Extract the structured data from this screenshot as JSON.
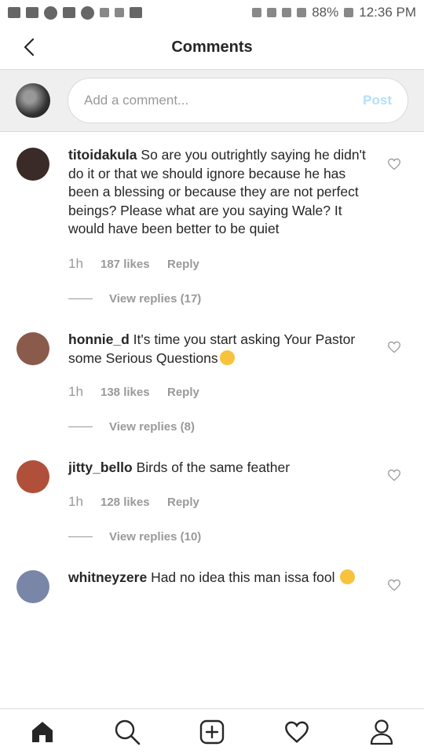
{
  "status_bar": {
    "battery": "88%",
    "time": "12:36 PM"
  },
  "header": {
    "title": "Comments"
  },
  "compose": {
    "placeholder": "Add a comment...",
    "post_label": "Post"
  },
  "comments": [
    {
      "username": "titoidakula",
      "text": "So are you outrightly saying he didn't do it or that we should ignore because he has been a blessing or because they are not perfect beings? Please what are you saying Wale? It would have been better to be quiet",
      "time": "1h",
      "likes": "187 likes",
      "reply_label": "Reply",
      "view_replies": "View replies (17)",
      "avatar_color": "#3a2a28"
    },
    {
      "username": "honnie_d",
      "text": "It's time you start asking Your Pastor some Serious Questions",
      "time": "1h",
      "likes": "138 likes",
      "reply_label": "Reply",
      "view_replies": "View replies (8)",
      "avatar_color": "#8a5a4a"
    },
    {
      "username": "jitty_bello",
      "text": "Birds of the same feather",
      "time": "1h",
      "likes": "128 likes",
      "reply_label": "Reply",
      "view_replies": "View replies (10)",
      "avatar_color": "#b0503a"
    },
    {
      "username": "whitneyzere",
      "text": "Had no idea this man issa fool",
      "avatar_color": "#7a86a8"
    }
  ],
  "bottom_nav": [
    "home-icon",
    "search-icon",
    "add-post-icon",
    "activity-heart-icon",
    "profile-icon"
  ]
}
